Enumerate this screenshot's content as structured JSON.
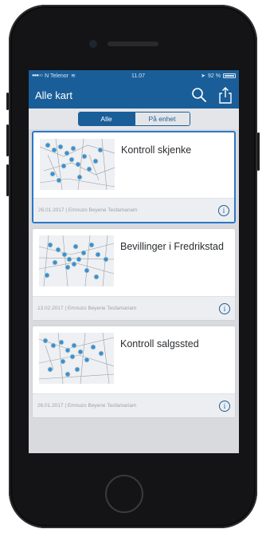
{
  "status_bar": {
    "carrier": "N Telenor",
    "time": "11.07",
    "battery": "92 %"
  },
  "navbar": {
    "title": "Alle kart",
    "search_icon": "search-icon",
    "share_icon": "share-icon"
  },
  "segmented": {
    "all_label": "Alle",
    "device_label": "På enhet",
    "selected": "Alle"
  },
  "maps": [
    {
      "title": "Kontroll skjenke",
      "meta": "26.01.2017 | Emnuzo Beyene Tesfamariam",
      "selected": true
    },
    {
      "title": "Bevillinger i Fredrikstad",
      "meta": "13.02.2017 | Emnuzo Beyene Tesfamariam",
      "selected": false
    },
    {
      "title": "Kontroll salgssted",
      "meta": "26.01.2017 | Emnuzo Beyene Tesfamariam",
      "selected": false
    }
  ],
  "colors": {
    "accent": "#1a5e99",
    "selection": "#2a78c8",
    "marker": "#3b8fd6"
  }
}
